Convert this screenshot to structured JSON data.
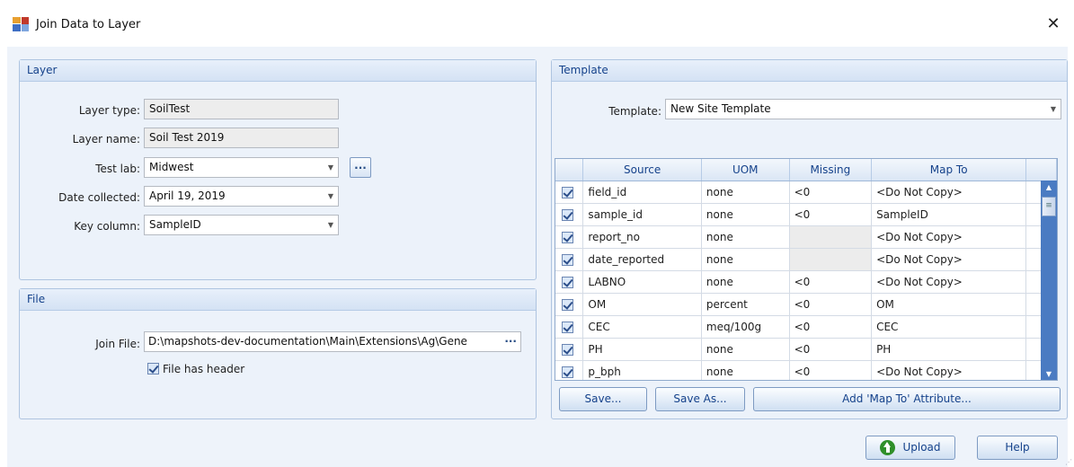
{
  "window": {
    "title": "Join Data to Layer",
    "close_symbol": "✕"
  },
  "layer": {
    "header": "Layer",
    "layer_type_label": "Layer type:",
    "layer_type_value": "SoilTest",
    "layer_name_label": "Layer name:",
    "layer_name_value": "Soil Test 2019",
    "test_lab_label": "Test lab:",
    "test_lab_value": "Midwest",
    "date_collected_label": "Date collected:",
    "date_collected_value": "April 19, 2019",
    "key_column_label": "Key column:",
    "key_column_value": "SampleID",
    "ellipsis_label": "..."
  },
  "file": {
    "header": "File",
    "join_file_label": "Join File:",
    "join_file_value": "D:\\mapshots-dev-documentation\\Main\\Extensions\\Ag\\Gene",
    "join_file_dots": "···",
    "has_header_label": "File has header"
  },
  "template": {
    "header": "Template",
    "template_label": "Template:",
    "template_value": "New Site Template",
    "columns": [
      "Source",
      "UOM",
      "Missing",
      "Map To"
    ],
    "rows": [
      {
        "source": "field_id",
        "uom": "none",
        "missing": "<0",
        "map_to": "<Do Not Copy>"
      },
      {
        "source": "sample_id",
        "uom": "none",
        "missing": "<0",
        "map_to": "SampleID"
      },
      {
        "source": "report_no",
        "uom": "none",
        "missing": "",
        "map_to": "<Do Not Copy>"
      },
      {
        "source": "date_reported",
        "uom": "none",
        "missing": "",
        "map_to": "<Do Not Copy>"
      },
      {
        "source": "LABNO",
        "uom": "none",
        "missing": "<0",
        "map_to": "<Do Not Copy>"
      },
      {
        "source": "OM",
        "uom": "percent",
        "missing": "<0",
        "map_to": "OM"
      },
      {
        "source": "CEC",
        "uom": "meq/100g",
        "missing": "<0",
        "map_to": "CEC"
      },
      {
        "source": "PH",
        "uom": "none",
        "missing": "<0",
        "map_to": "PH"
      },
      {
        "source": "p_bph",
        "uom": "none",
        "missing": "<0",
        "map_to": "<Do Not Copy>"
      }
    ],
    "save_label": "Save...",
    "save_as_label": "Save As...",
    "add_attr_label": "Add 'Map To' Attribute..."
  },
  "footer": {
    "upload_label": "Upload",
    "help_label": "Help"
  },
  "colors": {
    "accent": "#15428b",
    "scrollbar": "#4a7bc2",
    "upload_icon": "#2f8f2a"
  }
}
